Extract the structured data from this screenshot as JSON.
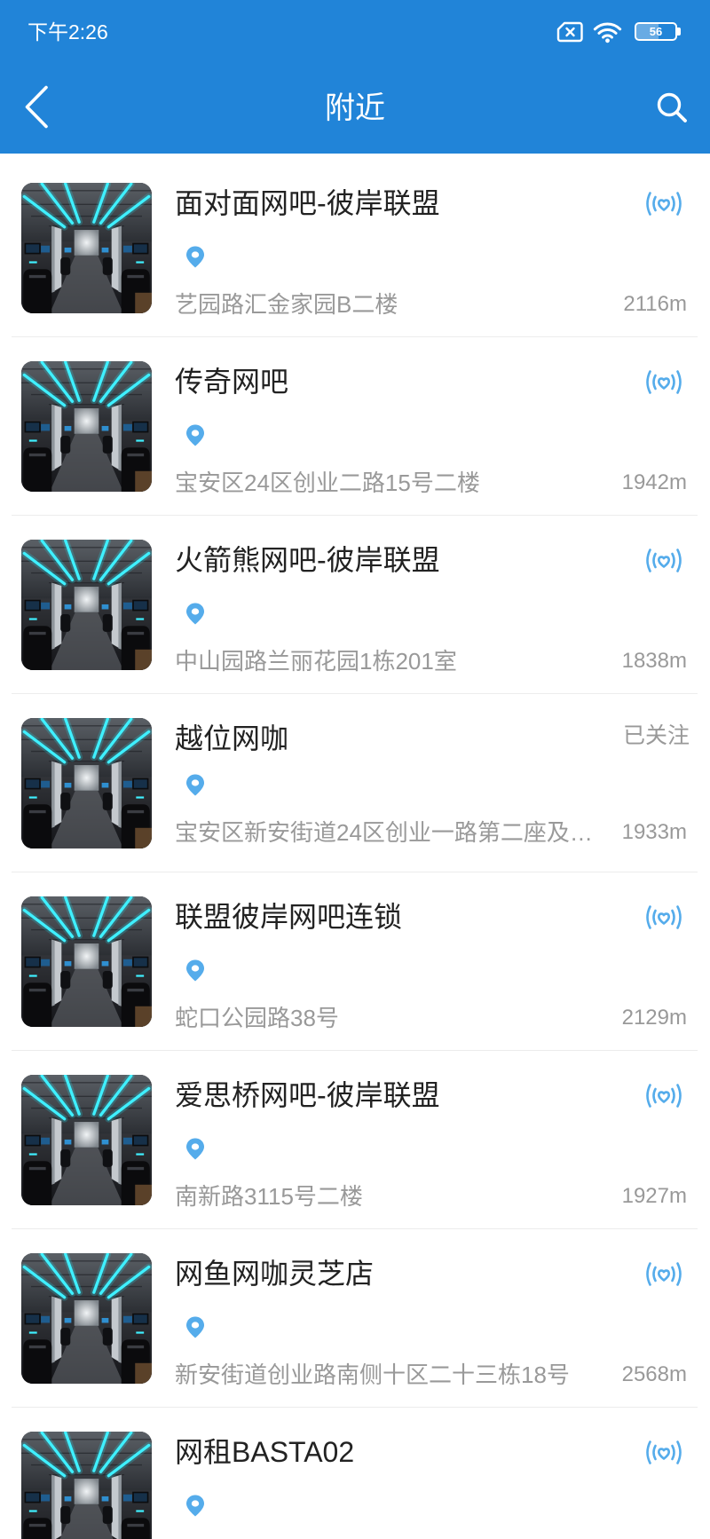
{
  "status_bar": {
    "time": "下午2:26",
    "battery": "56",
    "icons": [
      "no-sim-icon",
      "wifi-icon",
      "battery-icon"
    ]
  },
  "header": {
    "title": "附近",
    "back_icon": "chevron-left-icon",
    "search_icon": "search-icon"
  },
  "list": {
    "items": [
      {
        "name": "面对面网吧-彼岸联盟",
        "address": "艺园路汇金家园B二楼",
        "distance": "2116m",
        "badge_icon": "live-signal-icon"
      },
      {
        "name": "传奇网吧",
        "address": "宝安区24区创业二路15号二楼",
        "distance": "1942m",
        "badge_icon": "live-signal-icon"
      },
      {
        "name": "火箭熊网吧-彼岸联盟",
        "address": "中山园路兰丽花园1栋201室",
        "distance": "1838m",
        "badge_icon": "live-signal-icon"
      },
      {
        "name": "越位网咖",
        "address": "宝安区新安街道24区创业一路第二座及…",
        "distance": "1933m",
        "follow_status": "已关注"
      },
      {
        "name": "联盟彼岸网吧连锁",
        "address": "蛇口公园路38号",
        "distance": "2129m",
        "badge_icon": "live-signal-icon"
      },
      {
        "name": "爱思桥网吧-彼岸联盟",
        "address": "南新路3115号二楼",
        "distance": "1927m",
        "badge_icon": "live-signal-icon"
      },
      {
        "name": "网鱼网咖灵芝店",
        "address": "新安街道创业路南侧十区二十三栋18号",
        "distance": "2568m",
        "badge_icon": "live-signal-icon"
      },
      {
        "name": "网租BASTA02",
        "badge_icon": "live-signal-icon"
      }
    ]
  },
  "colors": {
    "primary": "#2184D8",
    "accent": "#55ACEB",
    "text_primary": "#222222",
    "text_secondary": "#999999",
    "divider": "#ECECEC"
  }
}
